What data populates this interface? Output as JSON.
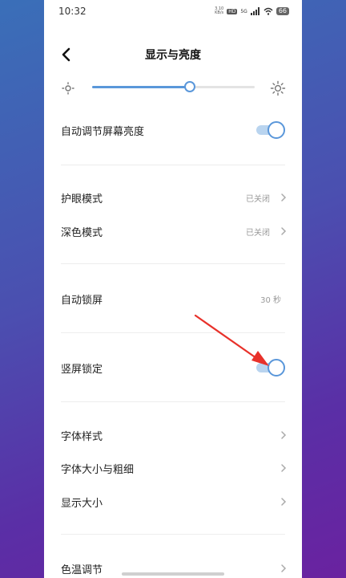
{
  "status_bar": {
    "time": "10:32",
    "net_speed_value": "3.10",
    "net_speed_unit": "KB/s",
    "hd_label": "HD",
    "signal_label": "5G",
    "battery": "66"
  },
  "header": {
    "title": "显示与亮度"
  },
  "brightness": {
    "level_fraction": 0.6
  },
  "settings": {
    "auto_brightness": {
      "label": "自动调节屏幕亮度",
      "on": true
    },
    "eye_care": {
      "label": "护眼模式",
      "value": "已关闭"
    },
    "dark_mode": {
      "label": "深色模式",
      "value": "已关闭"
    },
    "auto_lock": {
      "label": "自动锁屏",
      "value": "30 秒"
    },
    "portrait_lock": {
      "label": "竖屏锁定",
      "on": true
    },
    "font_style": {
      "label": "字体样式"
    },
    "font_size": {
      "label": "字体大小与粗细"
    },
    "display_size": {
      "label": "显示大小"
    },
    "color_temp": {
      "label": "色温调节"
    }
  },
  "colors": {
    "accent": "#5a97da",
    "toggle_track": "#b9d4ef",
    "annotation_arrow": "#e8312a"
  }
}
